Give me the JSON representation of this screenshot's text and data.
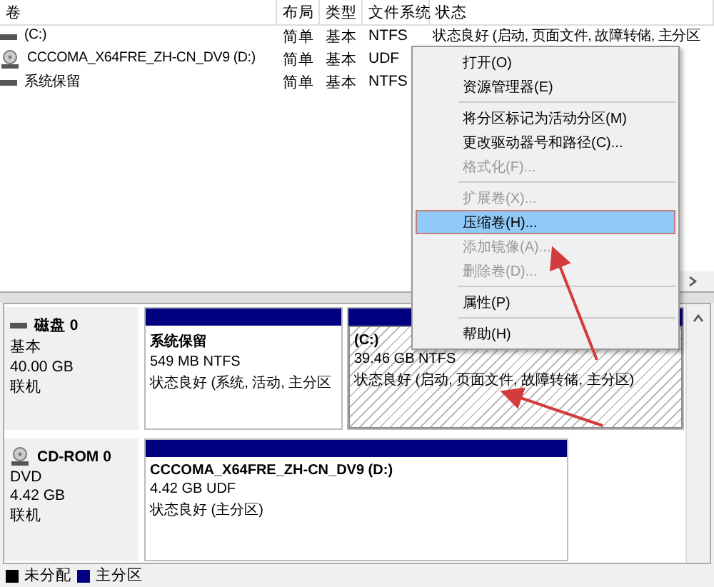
{
  "volume_table": {
    "columns": [
      "卷",
      "布局",
      "类型",
      "文件系统",
      "状态"
    ],
    "rows": [
      {
        "kind": "disk",
        "volume": "(C:)",
        "layout": "简单",
        "type": "基本",
        "file_system": "NTFS",
        "status": "状态良好 (启动, 页面文件, 故障转储, 主分区"
      },
      {
        "kind": "cd",
        "volume": "CCCOMA_X64FRE_ZH-CN_DV9 (D:)",
        "layout": "简单",
        "type": "基本",
        "file_system": "UDF"
      },
      {
        "kind": "disk",
        "volume": "系统保留",
        "layout": "简单",
        "type": "基本",
        "file_system": "NTFS"
      }
    ]
  },
  "disks": [
    {
      "kind": "disk",
      "name": "磁盘 0",
      "type": "基本",
      "size": "40.00 GB",
      "state": "联机",
      "partitions": [
        {
          "name": "系统保留",
          "size": "549 MB NTFS",
          "status": "状态良好 (系统, 活动, 主分区",
          "selected": false
        },
        {
          "name": "(C:)",
          "size": "39.46 GB NTFS",
          "status": "状态良好 (启动, 页面文件, 故障转储, 主分区)",
          "selected": true
        }
      ]
    },
    {
      "kind": "cd",
      "name": "CD-ROM 0",
      "type": "DVD",
      "size": "4.42 GB",
      "state": "联机",
      "partitions": [
        {
          "name": "CCCOMA_X64FRE_ZH-CN_DV9  (D:)",
          "size": "4.42 GB UDF",
          "status": "状态良好 (主分区)",
          "selected": false
        }
      ]
    }
  ],
  "legend": [
    {
      "label": "未分配",
      "color": "#000000"
    },
    {
      "label": "主分区",
      "color": "#000080"
    }
  ],
  "context_menu": {
    "items": [
      {
        "kind": "item",
        "label": "打开(O)",
        "disabled": false,
        "selected": false
      },
      {
        "kind": "item",
        "label": "资源管理器(E)",
        "disabled": false,
        "selected": false
      },
      {
        "kind": "separator"
      },
      {
        "kind": "item",
        "label": "将分区标记为活动分区(M)",
        "disabled": false,
        "selected": false
      },
      {
        "kind": "item",
        "label": "更改驱动器号和路径(C)...",
        "disabled": false,
        "selected": false
      },
      {
        "kind": "item",
        "label": "格式化(F)...",
        "disabled": true,
        "selected": false
      },
      {
        "kind": "separator"
      },
      {
        "kind": "item",
        "label": "扩展卷(X)...",
        "disabled": true,
        "selected": false
      },
      {
        "kind": "item",
        "label": "压缩卷(H)...",
        "disabled": false,
        "selected": true
      },
      {
        "kind": "item",
        "label": "添加镜像(A)...",
        "disabled": true,
        "selected": false
      },
      {
        "kind": "item",
        "label": "删除卷(D)...",
        "disabled": true,
        "selected": false
      },
      {
        "kind": "separator"
      },
      {
        "kind": "item",
        "label": "属性(P)",
        "disabled": false,
        "selected": false
      },
      {
        "kind": "separator"
      },
      {
        "kind": "item",
        "label": "帮助(H)",
        "disabled": false,
        "selected": false
      }
    ]
  }
}
